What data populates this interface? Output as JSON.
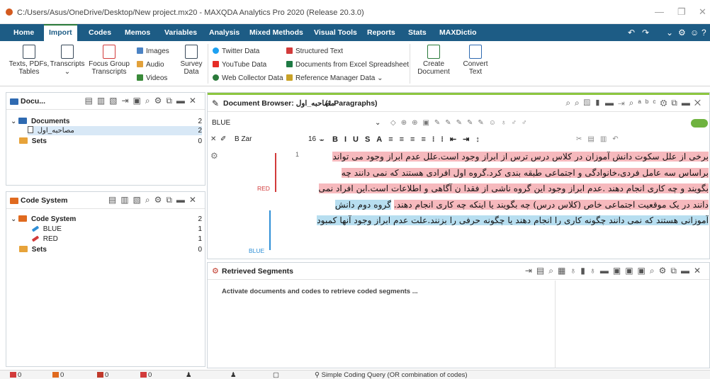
{
  "window": {
    "title": "C:/Users/Asus/OneDrive/Desktop/New project.mx20 - MAXQDA Analytics Pro 2020 (Release 20.3.0)"
  },
  "menu": {
    "items": [
      "Home",
      "Import",
      "Codes",
      "Memos",
      "Variables",
      "Analysis",
      "Mixed Methods",
      "Visual Tools",
      "Reports",
      "Stats",
      "MAXDictio"
    ],
    "active": "Import"
  },
  "ribbon": {
    "texts": "Texts, PDFs,",
    "tables": "Tables",
    "transcripts": "Transcripts",
    "focus_group": "Focus Group",
    "focus_group_2": "Transcripts",
    "images": "Images",
    "audio": "Audio",
    "videos": "Videos",
    "survey": "Survey",
    "survey_2": "Data",
    "twitter": "Twitter Data",
    "youtube": "YouTube Data",
    "web_collector": "Web Collector Data",
    "structured": "Structured Text",
    "excel": "Documents from Excel Spreadsheet",
    "reference": "Reference Manager Data",
    "create": "Create",
    "create_2": "Document",
    "convert": "Convert",
    "convert_2": "Text"
  },
  "documents_panel": {
    "title": "Docu...",
    "root": "Documents",
    "root_count": "2",
    "doc": "مصاحبه_اول",
    "doc_count": "2",
    "sets": "Sets",
    "sets_count": "0"
  },
  "code_system_panel": {
    "title": "Code System",
    "root": "Code System",
    "root_count": "2",
    "codes": [
      {
        "name": "BLUE",
        "count": "1",
        "color": "#2f8fd6"
      },
      {
        "name": "RED",
        "count": "1",
        "color": "#d23b3b"
      }
    ],
    "sets": "Sets",
    "sets_count": "0"
  },
  "document_browser": {
    "title": "Document Browser: مصاحبه_اول",
    "paragraphs": "(1 Paragraphs)",
    "code_selector": "BLUE",
    "font": "B Zar",
    "font_size": "16",
    "line_number": "1",
    "code_labels": {
      "red": "RED",
      "blue": "BLUE"
    },
    "lines": [
      "برخی از علل سکوت دانش آموزان در کلاس درس ترس از ابراز وجود است.علل عدم ابراز وجود می تواند",
      "براساس سه عامل فردی،خانوادگی و اجتماعی طبقه بندی کرد.گروه اول افرادی هستند که نمی دانند چه",
      "بگویند و چه کاری انجام دهند .عدم ابراز وجود این گروه ناشی از فقدا ن آگاهی  و اطلاعات است.این افراد نمی",
      "دانند در یک موقعیت اجتماعی خاص (کلاس درس) چه بگویند یا اینکه چه کاری انجام دهند.",
      "گروه دوم دانش",
      "آموزانی هستند که نمی دانند چگونه کاری را انجام دهند یا چگونه حرفی را بزنند.علت عدم ابراز وجود آنها کمبود"
    ]
  },
  "retrieved_segments": {
    "title": "Retrieved Segments",
    "message": "Activate documents and codes to retrieve coded segments ..."
  },
  "statusbar": {
    "docs": "0",
    "codes": "0",
    "links": "0",
    "memos": "0",
    "query": "Simple Coding Query (OR combination of codes)"
  }
}
